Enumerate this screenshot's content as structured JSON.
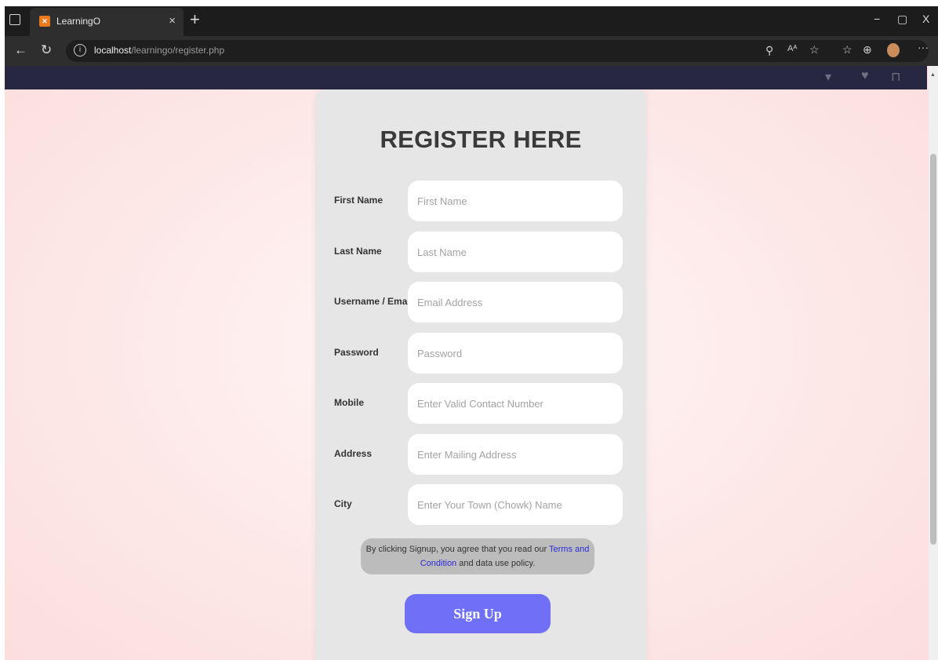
{
  "browser": {
    "tab_title": "LearningO",
    "tab_favicon": "XAMPP",
    "tab_close": "×",
    "new_tab": "+",
    "url_host": "localhost",
    "url_path": "/learningo/register.php",
    "window_controls": [
      "−",
      "▢",
      "X"
    ]
  },
  "site_nav": {
    "icons": [
      "user-icon",
      "heart-icon",
      "cart-icon"
    ]
  },
  "form": {
    "title": "REGISTER HERE",
    "fields": [
      {
        "label": "First Name",
        "placeholder": "First Name",
        "value": ""
      },
      {
        "label": "Last Name",
        "placeholder": "Last Name",
        "value": ""
      },
      {
        "label": "Username / Email",
        "placeholder": "Email Address",
        "value": ""
      },
      {
        "label": "Password",
        "placeholder": "Password",
        "value": ""
      },
      {
        "label": "Mobile",
        "placeholder": "Enter Valid Contact Number",
        "value": ""
      },
      {
        "label": "Address",
        "placeholder": "Enter Mailing Address",
        "value": ""
      },
      {
        "label": "City",
        "placeholder": "Enter Your Town (Chowk) Name",
        "value": ""
      }
    ],
    "notice_before": "By clicking Signup, you agree that you read our ",
    "notice_link": "Terms and Condition",
    "notice_after": " and data use policy.",
    "submit_label": "Sign Up"
  },
  "colors": {
    "page_bg": "#fde3e3",
    "card_bg": "#e6e6e6",
    "site_nav_bg": "#272742",
    "button_bg": "#6f70f5",
    "notice_bg": "#bcbcbc",
    "link": "#2b2bd6"
  }
}
